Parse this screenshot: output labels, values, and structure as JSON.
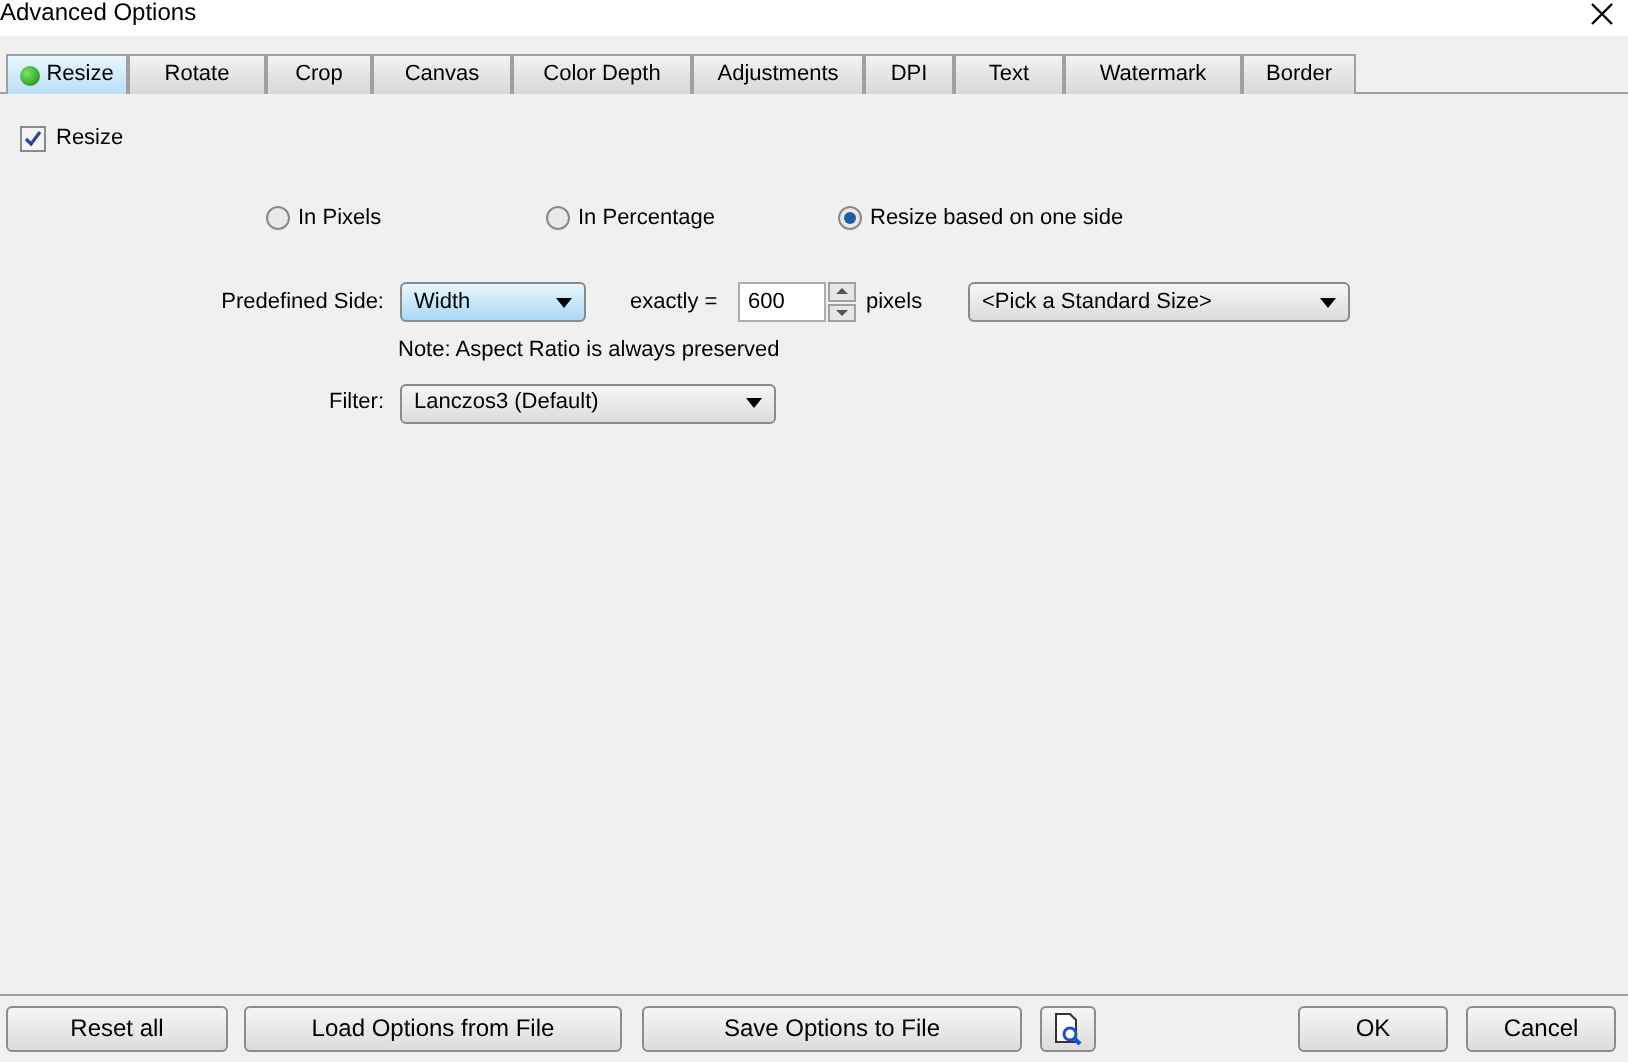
{
  "window": {
    "title": "Advanced Options"
  },
  "tabs": [
    {
      "label": "Resize",
      "selected": true,
      "status_dot": true
    },
    {
      "label": "Rotate",
      "selected": false
    },
    {
      "label": "Crop",
      "selected": false
    },
    {
      "label": "Canvas",
      "selected": false
    },
    {
      "label": "Color Depth",
      "selected": false
    },
    {
      "label": "Adjustments",
      "selected": false
    },
    {
      "label": "DPI",
      "selected": false
    },
    {
      "label": "Text",
      "selected": false
    },
    {
      "label": "Watermark",
      "selected": false
    },
    {
      "label": "Border",
      "selected": false
    }
  ],
  "resize_checkbox": {
    "label": "Resize",
    "checked": true
  },
  "modes": [
    {
      "label": "In Pixels",
      "selected": false
    },
    {
      "label": "In Percentage",
      "selected": false
    },
    {
      "label": "Resize based on one side",
      "selected": true
    }
  ],
  "predefined_side": {
    "label": "Predefined Side:",
    "value": "Width",
    "exactly_label": "exactly =",
    "amount": "600",
    "unit": "pixels",
    "standard_size": "<Pick a Standard Size>"
  },
  "note": "Note: Aspect Ratio is always preserved",
  "filter": {
    "label": "Filter:",
    "value": "Lanczos3 (Default)"
  },
  "buttons": {
    "reset": "Reset all",
    "load": "Load Options from File",
    "save": "Save Options to File",
    "ok": "OK",
    "cancel": "Cancel"
  }
}
